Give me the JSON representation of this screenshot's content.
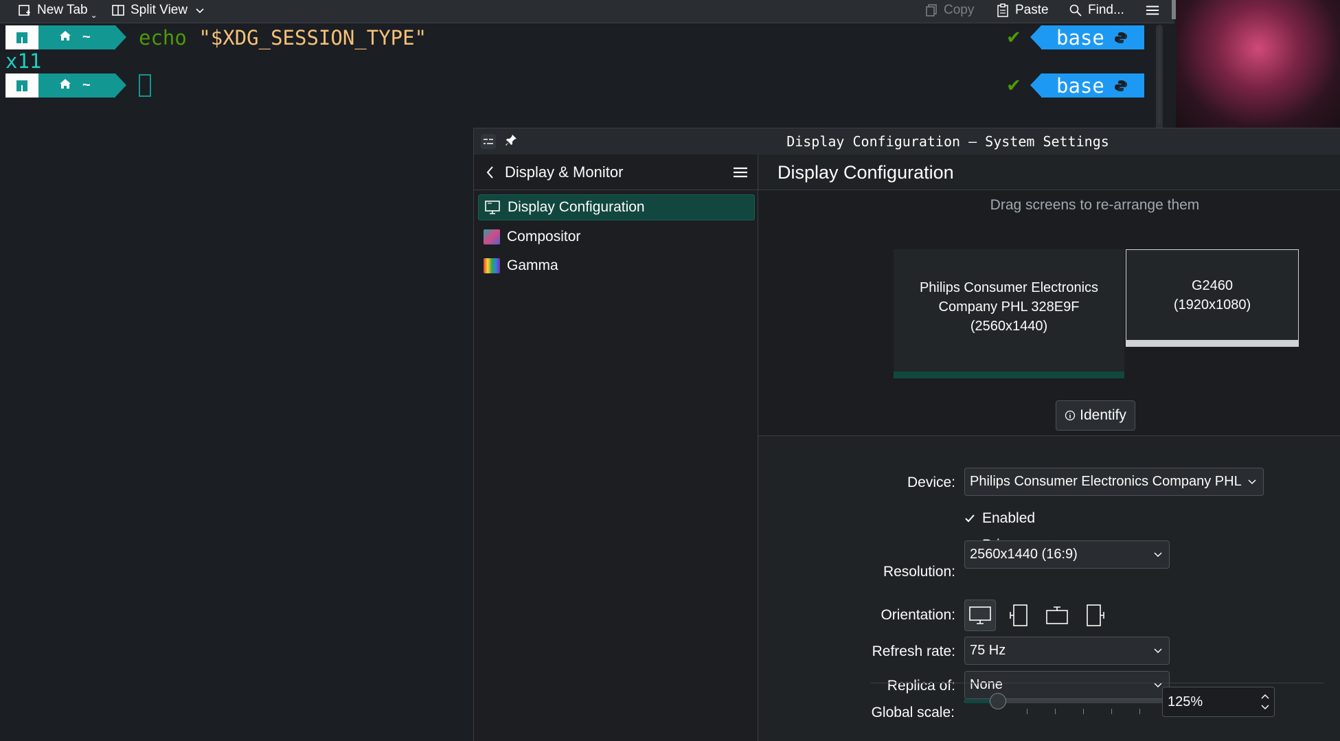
{
  "terminal": {
    "toolbar": {
      "new_tab": "New Tab",
      "split_view": "Split View",
      "copy": "Copy",
      "paste": "Paste",
      "find": "Find..."
    },
    "lines": [
      {
        "cmd_keyword": "echo",
        "cmd_arg": "\"$XDG_SESSION_TYPE\""
      },
      {
        "output": "x11"
      }
    ],
    "env_label": "base",
    "colors": {
      "dir_segment": "#139793",
      "env_segment": "#1d99f3"
    }
  },
  "settings": {
    "window_title": "Display Configuration — System Settings",
    "sidebar": {
      "title": "Display & Monitor",
      "items": [
        {
          "label": "Display Configuration",
          "icon": "monitor-icon",
          "active": true
        },
        {
          "label": "Compositor",
          "icon": "compositor-icon",
          "active": false
        },
        {
          "label": "Gamma",
          "icon": "gamma-icon",
          "active": false
        }
      ]
    },
    "page_title": "Display Configuration",
    "drag_hint": "Drag screens to re-arrange them",
    "screens": [
      {
        "line1": "Philips Consumer Electronics",
        "line2": "Company PHL 328E9F",
        "line3": "(2560x1440)"
      },
      {
        "line1": "G2460",
        "line2": "(1920x1080)"
      }
    ],
    "identify_label": "Identify",
    "form": {
      "device_label": "Device:",
      "device_value": "Philips Consumer Electronics Company PHL",
      "enabled_label": "Enabled",
      "primary_label": "Primary",
      "resolution_label": "Resolution:",
      "resolution_value": "2560x1440 (16:9)",
      "orientation_label": "Orientation:",
      "refresh_label": "Refresh rate:",
      "refresh_value": "75 Hz",
      "replica_label": "Replica of:",
      "replica_value": "None",
      "scale_label": "Global scale:",
      "scale_value": "125%"
    },
    "colors": {
      "accent": "#12473f",
      "background": "#202326"
    }
  }
}
